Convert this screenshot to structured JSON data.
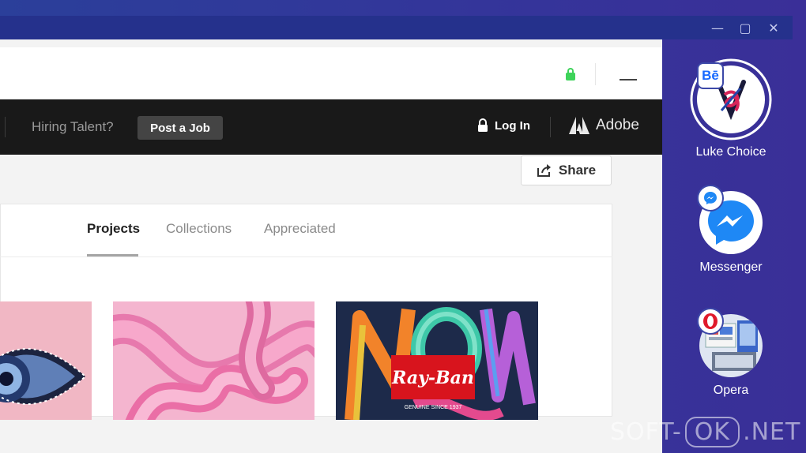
{
  "window": {
    "controls": {
      "minimize": "—",
      "maximize": "▢",
      "close": "✕"
    }
  },
  "browser": {
    "topnav": {
      "hiring_text": "Hiring Talent?",
      "post_job_label": "Post a Job",
      "login_label": "Log In",
      "adobe_label": "Adobe"
    },
    "share_label": "Share",
    "tabs": [
      {
        "label": "Projects",
        "active": true
      },
      {
        "label": "Collections",
        "active": false
      },
      {
        "label": "Appreciated",
        "active": false
      }
    ],
    "thumbnails": [
      {
        "name": "eye-artwork"
      },
      {
        "name": "pink-tubes-artwork"
      },
      {
        "name": "ray-ban-now-artwork",
        "brand_text": "Ray-Ban",
        "brand_subtext": "GENUINE SINCE 1937"
      }
    ]
  },
  "sidebar": {
    "apps": [
      {
        "label": "Luke Choice",
        "badge": "Bē",
        "icon": "behance-icon"
      },
      {
        "label": "Messenger",
        "icon": "messenger-icon"
      },
      {
        "label": "Opera",
        "icon": "opera-icon"
      }
    ]
  },
  "watermark": {
    "left": "SOFT-",
    "boxed": "OK",
    "right": ".NET"
  },
  "colors": {
    "sidebar_bg": "#33369a",
    "nav_bg": "#191919",
    "lock_green": "#3ed35a",
    "messenger_blue": "#1e88f5",
    "opera_red": "#e01a2b",
    "rayban_red": "#d8141d"
  }
}
